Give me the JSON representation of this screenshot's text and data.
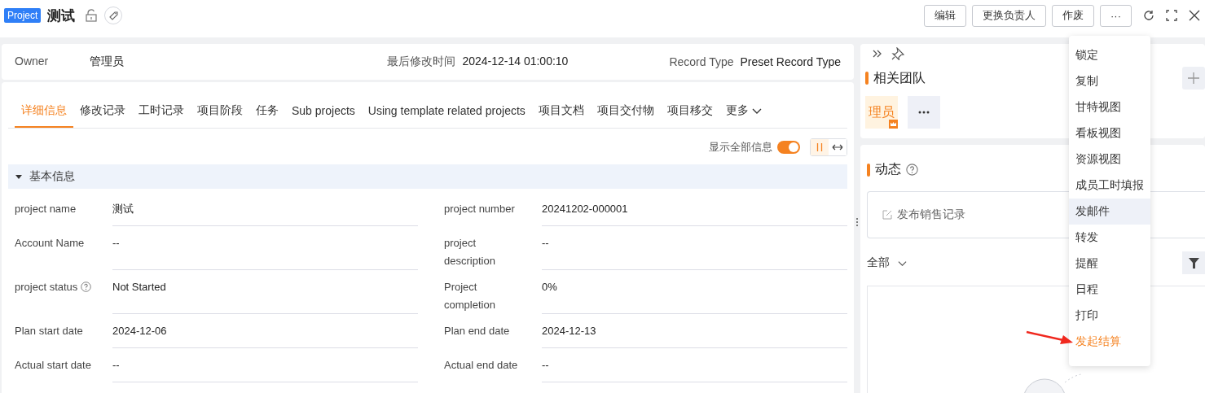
{
  "header": {
    "tag": "Project",
    "title": "测试",
    "locked": false,
    "buttons": [
      "编辑",
      "更换负责人",
      "作废",
      "···"
    ]
  },
  "summary": [
    {
      "label": "Owner",
      "value": "管理员"
    },
    {
      "label": "最后修改时间",
      "value": "2024-12-14 01:00:10"
    },
    {
      "label": "Record Type",
      "value": "Preset Record Type"
    }
  ],
  "tabs": [
    {
      "label": "详细信息",
      "selected": true
    },
    {
      "label": "修改记录",
      "selected": false
    },
    {
      "label": "工时记录",
      "selected": false
    },
    {
      "label": "项目阶段",
      "selected": false
    },
    {
      "label": "任务",
      "selected": false
    },
    {
      "label": "Sub projects",
      "selected": false
    },
    {
      "label": "Using template related projects",
      "selected": false
    },
    {
      "label": "项目文档",
      "selected": false
    },
    {
      "label": "项目交付物",
      "selected": false
    },
    {
      "label": "项目移交",
      "selected": false
    }
  ],
  "more_tab": "更多",
  "show_all": {
    "label": "显示全部信息",
    "on": true
  },
  "layout_toggle": [
    {
      "kind": "columns",
      "selected": true
    },
    {
      "kind": "wide",
      "selected": false
    }
  ],
  "section": {
    "title": "基本信息",
    "expanded": true
  },
  "fields": [
    [
      {
        "label": "project name",
        "value": "测试",
        "help": false
      },
      {
        "label": "project number",
        "value": "20241202-000001",
        "help": false
      }
    ],
    [
      {
        "label": "Account Name",
        "value": "--",
        "help": false
      },
      {
        "label": "project description",
        "value": "--",
        "help": false
      }
    ],
    [
      {
        "label": "project status",
        "value": "Not Started",
        "help": true
      },
      {
        "label": "Project completion",
        "value": "0%",
        "help": false
      }
    ],
    [
      {
        "label": "Plan start date",
        "value": "2024-12-06",
        "help": false
      },
      {
        "label": "Plan end date",
        "value": "2024-12-13",
        "help": false
      }
    ],
    [
      {
        "label": "Actual start date",
        "value": "--",
        "help": false
      },
      {
        "label": "Actual end date",
        "value": "--",
        "help": false
      }
    ]
  ],
  "team": {
    "title": "相关团队",
    "members": [
      {
        "name": "理员",
        "owner": true
      }
    ]
  },
  "activity": {
    "title": "动态",
    "post_placeholder": "发布销售记录",
    "filter": "全部"
  },
  "menu": [
    {
      "label": "锁定",
      "hovered": false,
      "accent": false
    },
    {
      "label": "复制",
      "hovered": false,
      "accent": false
    },
    {
      "label": "甘特视图",
      "hovered": false,
      "accent": false
    },
    {
      "label": "看板视图",
      "hovered": false,
      "accent": false
    },
    {
      "label": "资源视图",
      "hovered": false,
      "accent": false
    },
    {
      "label": "成员工时填报",
      "hovered": false,
      "accent": false
    },
    {
      "label": "发邮件",
      "hovered": true,
      "accent": false
    },
    {
      "label": "转发",
      "hovered": false,
      "accent": false
    },
    {
      "label": "提醒",
      "hovered": false,
      "accent": false
    },
    {
      "label": "日程",
      "hovered": false,
      "accent": false
    },
    {
      "label": "打印",
      "hovered": false,
      "accent": false
    },
    {
      "label": "发起结算",
      "hovered": false,
      "accent": true
    }
  ]
}
